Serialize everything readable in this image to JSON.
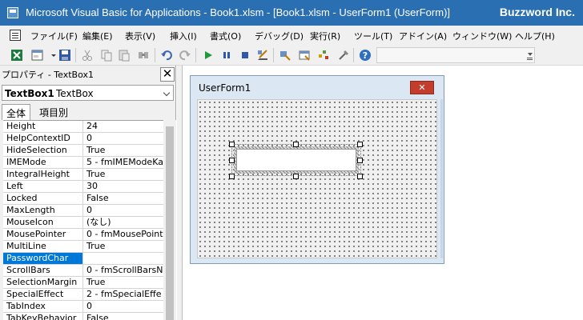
{
  "window": {
    "title": "Microsoft Visual Basic for Applications - Book1.xlsm - [Book1.xlsm - UserForm1 (UserForm)]",
    "watermark": "Buzzword Inc."
  },
  "menu": [
    {
      "label": "ファイル(F)"
    },
    {
      "label": "編集(E)"
    },
    {
      "label": "表示(V)"
    },
    {
      "label": "挿入(I)"
    },
    {
      "label": "書式(O)"
    },
    {
      "label": "デバッグ(D)"
    },
    {
      "label": "実行(R)"
    },
    {
      "label": "ツール(T)"
    },
    {
      "label": "アドイン(A)"
    },
    {
      "label": "ウィンドウ(W)"
    },
    {
      "label": "ヘルプ(H)"
    }
  ],
  "toolbar": {
    "icons": [
      "excel-view-icon",
      "insert-userform-icon",
      "save-icon",
      "cut-icon",
      "copy-icon",
      "paste-icon",
      "find-icon",
      "undo-icon",
      "redo-icon",
      "run-icon",
      "break-icon",
      "reset-icon",
      "design-mode-icon",
      "project-explorer-icon",
      "properties-window-icon",
      "object-browser-icon",
      "toolbox-icon",
      "help-icon"
    ]
  },
  "properties": {
    "title": "プロパティ - TextBox1",
    "close_glyph": "✕",
    "object_name": "TextBox1",
    "object_type": "TextBox",
    "tabs": [
      "全体",
      "項目別"
    ],
    "rows": [
      {
        "name": "Height",
        "value": "24"
      },
      {
        "name": "HelpContextID",
        "value": "0"
      },
      {
        "name": "HideSelection",
        "value": "True"
      },
      {
        "name": "IMEMode",
        "value": "5 - fmIMEModeKa"
      },
      {
        "name": "IntegralHeight",
        "value": "True"
      },
      {
        "name": "Left",
        "value": "30"
      },
      {
        "name": "Locked",
        "value": "False"
      },
      {
        "name": "MaxLength",
        "value": "0"
      },
      {
        "name": "MouseIcon",
        "value": "(なし)"
      },
      {
        "name": "MousePointer",
        "value": "0 - fmMousePoint"
      },
      {
        "name": "MultiLine",
        "value": "True"
      },
      {
        "name": "PasswordChar",
        "value": ""
      },
      {
        "name": "ScrollBars",
        "value": "0 - fmScrollBarsN"
      },
      {
        "name": "SelectionMargin",
        "value": "True"
      },
      {
        "name": "SpecialEffect",
        "value": "2 - fmSpecialEffe"
      },
      {
        "name": "TabIndex",
        "value": "0"
      },
      {
        "name": "TabKeyBehavior",
        "value": "False"
      }
    ]
  },
  "userform": {
    "title": "UserForm1",
    "close_glyph": "✕"
  },
  "colors": {
    "titlebar": "#2b6fb3",
    "selection": "#0078d7",
    "close_button": "#c43c2c"
  }
}
